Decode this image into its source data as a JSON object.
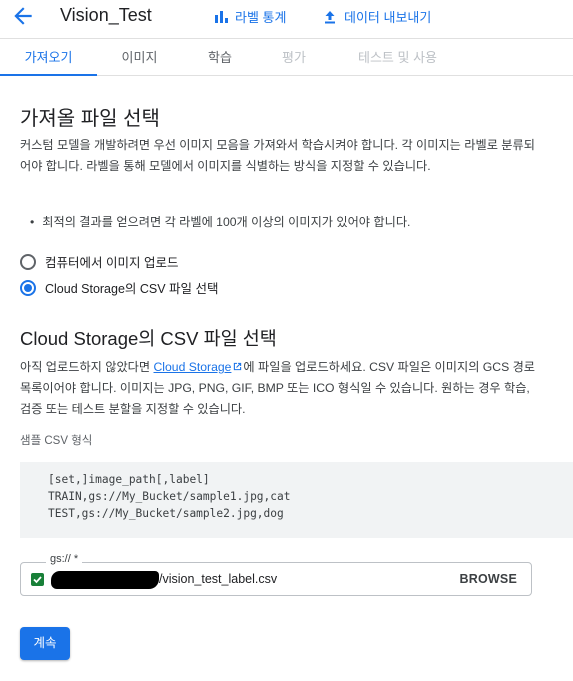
{
  "header": {
    "title": "Vision_Test",
    "stats_label": "라벨 통계",
    "export_label": "데이터 내보내기"
  },
  "tabs": [
    {
      "label": "가져오기",
      "state": "active"
    },
    {
      "label": "이미지",
      "state": "enabled"
    },
    {
      "label": "학습",
      "state": "enabled"
    },
    {
      "label": "평가",
      "state": "disabled"
    },
    {
      "label": "테스트 및 사용",
      "state": "disabled"
    }
  ],
  "main": {
    "heading": "가져올 파일 선택",
    "description": "커스텀 모델을 개발하려면 우선 이미지 모음을 가져와서 학습시켜야 합니다. 각 이미지는 라벨로 분류되어야 합니다. 라벨을 통해 모델에서 이미지를 식별하는 방식을 지정할 수 있습니다.",
    "bullet": "최적의 결과를 얻으려면 각 라벨에 100개 이상의 이미지가 있어야 합니다.",
    "options": [
      {
        "label": "컴퓨터에서 이미지 업로드",
        "selected": false
      },
      {
        "label": "Cloud Storage의 CSV 파일 선택",
        "selected": true
      }
    ]
  },
  "csv_section": {
    "heading": "Cloud Storage의 CSV 파일 선택",
    "text_before_link": "아직 업로드하지 않았다면 ",
    "link_text": "Cloud Storage",
    "text_after_link": "에 파일을 업로드하세요. CSV 파일은 이미지의 GCS 경로 목록이어야 합니다. 이미지는 JPG, PNG, GIF, BMP 또는 ICO 형식일 수 있습니다. 원하는 경우 학습, 검증 또는 테스트 분할을 지정할 수 있습니다.",
    "sample_label": "샘플 CSV 형식",
    "sample_lines": [
      "[set,]image_path[,label]",
      "TRAIN,gs://My_Bucket/sample1.jpg,cat",
      "TEST,gs://My_Bucket/sample2.jpg,dog"
    ],
    "field_label": "gs:// *",
    "field_value": "/vision_test_label.csv",
    "browse_label": "BROWSE"
  },
  "footer": {
    "continue_label": "계속"
  },
  "colors": {
    "accent": "#1a73e8",
    "valid": "#188038"
  }
}
